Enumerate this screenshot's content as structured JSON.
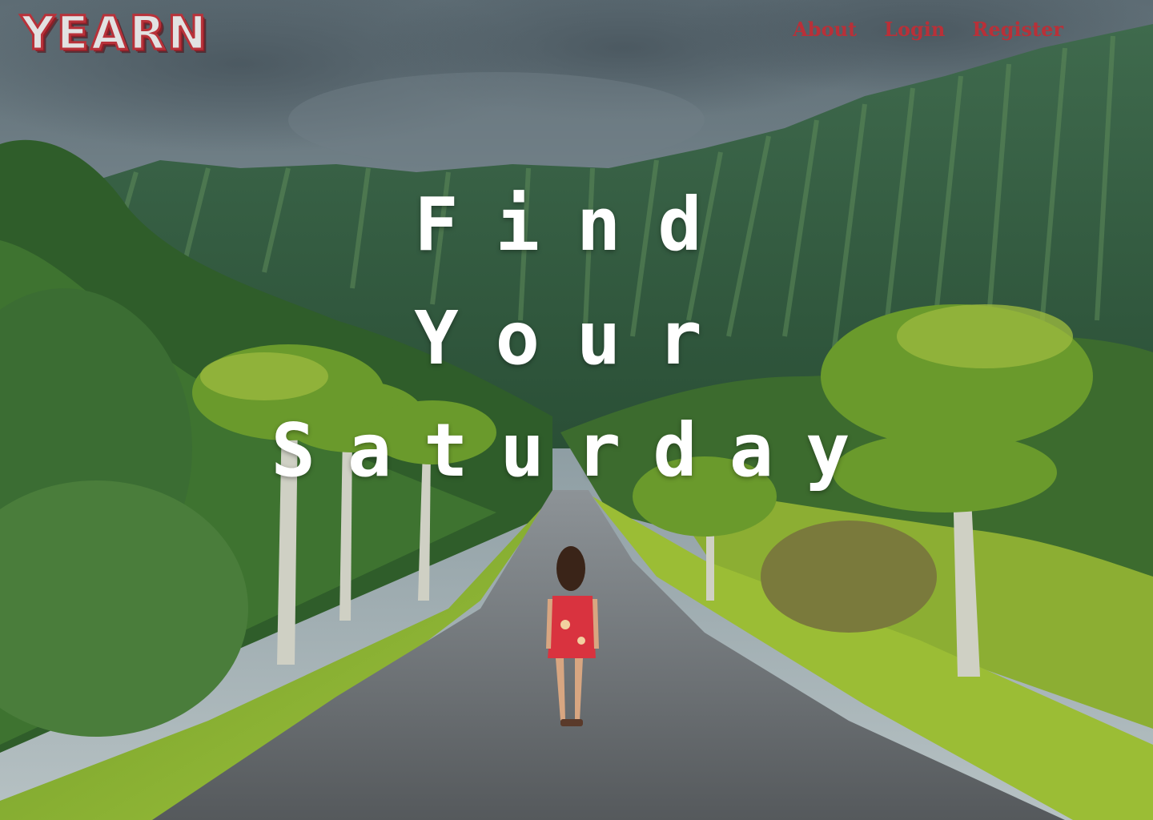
{
  "brand": {
    "logo_text": "YEARN"
  },
  "nav": {
    "items": [
      {
        "label": "About"
      },
      {
        "label": "Login"
      },
      {
        "label": "Register"
      }
    ]
  },
  "hero": {
    "line1": "Find",
    "line2": "Your",
    "line3": "Saturday"
  },
  "colors": {
    "brand_red": "#b93038",
    "hero_text": "#ffffff"
  }
}
